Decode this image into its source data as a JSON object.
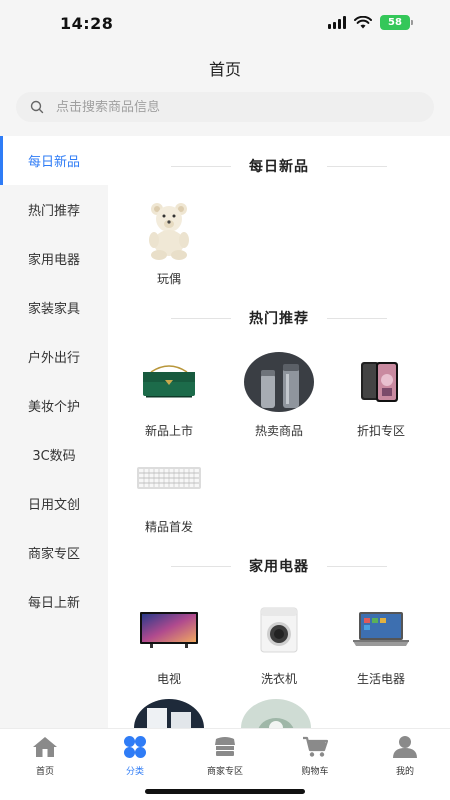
{
  "status": {
    "time": "14:28",
    "battery": "58"
  },
  "header": {
    "title": "首页"
  },
  "search": {
    "placeholder": "点击搜索商品信息"
  },
  "sidebar": {
    "items": [
      {
        "label": "每日新品",
        "active": true
      },
      {
        "label": "热门推荐"
      },
      {
        "label": "家用电器"
      },
      {
        "label": "家装家具"
      },
      {
        "label": "户外出行"
      },
      {
        "label": "美妆个护"
      },
      {
        "label": "3C数码"
      },
      {
        "label": "日用文创"
      },
      {
        "label": "商家专区"
      },
      {
        "label": "每日上新"
      }
    ]
  },
  "sections": [
    {
      "title": "每日新品",
      "items": [
        {
          "label": "玩偶",
          "icon": "teddy-bear-image"
        }
      ]
    },
    {
      "title": "热门推荐",
      "items": [
        {
          "label": "新品上市",
          "icon": "green-handbag-image"
        },
        {
          "label": "热卖商品",
          "icon": "thermos-image"
        },
        {
          "label": "折扣专区",
          "icon": "smartphone-image"
        },
        {
          "label": "精品首发",
          "icon": "keyboard-image"
        }
      ]
    },
    {
      "title": "家用电器",
      "items": [
        {
          "label": "电视",
          "icon": "tv-image"
        },
        {
          "label": "洗衣机",
          "icon": "washing-machine-image"
        },
        {
          "label": "生活电器",
          "icon": "laptop-image"
        }
      ]
    }
  ],
  "tabbar": {
    "items": [
      {
        "label": "首页",
        "icon": "home-icon"
      },
      {
        "label": "分类",
        "icon": "category-icon",
        "active": true
      },
      {
        "label": "商家专区",
        "icon": "store-icon"
      },
      {
        "label": "购物车",
        "icon": "cart-icon"
      },
      {
        "label": "我的",
        "icon": "profile-icon"
      }
    ]
  },
  "colors": {
    "accent": "#2f7cf6",
    "battery": "#34c759"
  }
}
